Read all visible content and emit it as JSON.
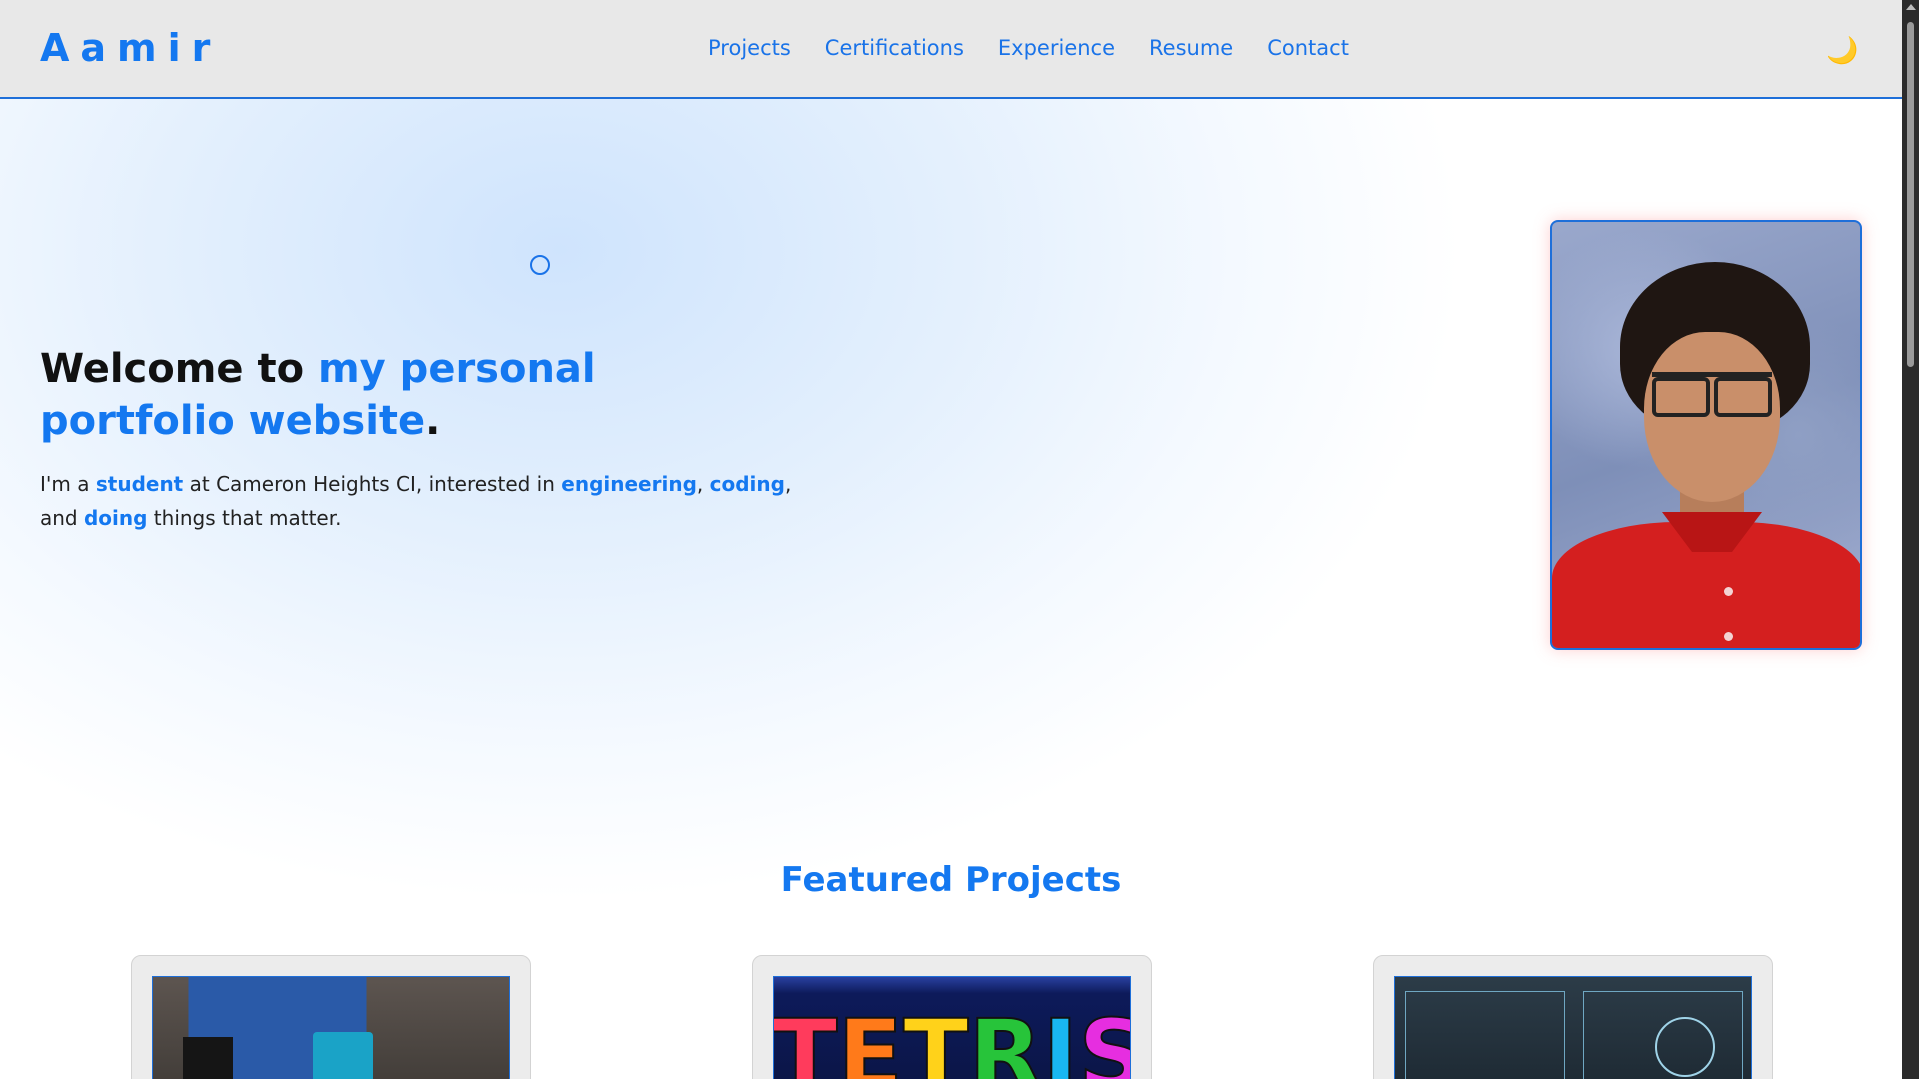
{
  "header": {
    "brand": "Aamir",
    "nav": [
      "Projects",
      "Certifications",
      "Experience",
      "Resume",
      "Contact"
    ],
    "theme_toggle_icon": "moon-icon",
    "theme_toggle_glyph": "🌙"
  },
  "hero": {
    "title_prefix": "Welcome to ",
    "title_accent": "my personal portfolio website",
    "title_suffix": ".",
    "text": {
      "p1": "I'm a ",
      "k1": "student",
      "p2": " at Cameron Heights CI, interested in ",
      "k2": "engineering",
      "p3": ", ",
      "k3": "coding",
      "p4": ", and ",
      "k4": "doing",
      "p5": " things that matter."
    }
  },
  "featured": {
    "title": "Featured Projects"
  },
  "tetris_letters": [
    {
      "char": "T",
      "color": "#ff3b5c"
    },
    {
      "char": "E",
      "color": "#ff7a1a"
    },
    {
      "char": "T",
      "color": "#ffd21a"
    },
    {
      "char": "R",
      "color": "#27c43a"
    },
    {
      "char": "I",
      "color": "#19b7f0"
    },
    {
      "char": "S",
      "color": "#e62ee0"
    }
  ],
  "colors": {
    "accent": "#1478f0",
    "nav_bg": "#e8e8e8",
    "nav_border": "#1e6fd9"
  }
}
